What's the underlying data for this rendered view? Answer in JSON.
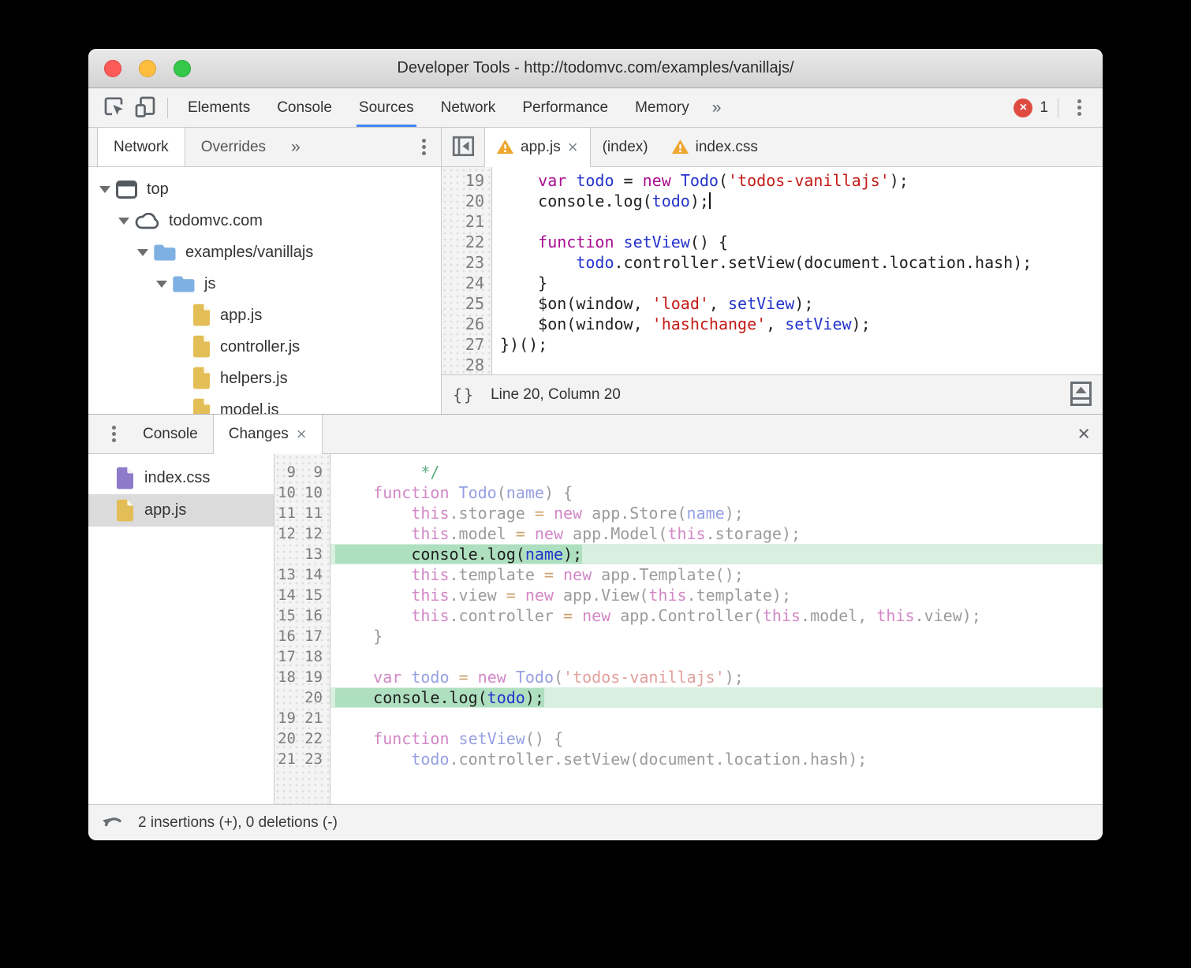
{
  "window": {
    "title": "Developer Tools - http://todomvc.com/examples/vanillajs/",
    "controls": [
      "close",
      "minimize",
      "maximize"
    ]
  },
  "colors": {
    "accent_blue": "#4285f4",
    "error_red": "#df4b41",
    "warning_amber": "#efa62f",
    "folder_blue": "#7fb0e3",
    "js_file_yellow": "#e3bd56",
    "css_file_purple": "#8d7ac9",
    "added_line_bg": "#d9efe0",
    "added_text_bg": "#aedfbf"
  },
  "ui": {
    "close_glyph": "×"
  },
  "toolbar": {
    "tabs": [
      "Elements",
      "Console",
      "Sources",
      "Network",
      "Performance",
      "Memory"
    ],
    "selected_tab": "Sources",
    "more_tabs_glyph": "»",
    "error_glyph": "×",
    "error_count": "1"
  },
  "sources": {
    "sidebar": {
      "tabs": [
        "Network",
        "Overrides"
      ],
      "selected_tab": "Network",
      "more_tabs_glyph": "»",
      "tree": [
        {
          "label": "top",
          "depth": 0,
          "icon": "frame-icon",
          "expanded": true
        },
        {
          "label": "todomvc.com",
          "depth": 1,
          "icon": "cloud-icon",
          "expanded": true
        },
        {
          "label": "examples/vanillajs",
          "depth": 2,
          "icon": "folder-icon",
          "expanded": true
        },
        {
          "label": "js",
          "depth": 3,
          "icon": "folder-icon",
          "expanded": true
        },
        {
          "label": "app.js",
          "depth": 4,
          "icon": "file-js-icon"
        },
        {
          "label": "controller.js",
          "depth": 4,
          "icon": "file-js-icon"
        },
        {
          "label": "helpers.js",
          "depth": 4,
          "icon": "file-js-icon"
        },
        {
          "label": "model.js",
          "depth": 4,
          "icon": "file-js-icon"
        }
      ]
    },
    "editor": {
      "tabs": [
        {
          "label": "app.js",
          "warning": true,
          "closable": true,
          "active": true
        },
        {
          "label": "(index)",
          "warning": false,
          "closable": false,
          "active": false
        },
        {
          "label": "index.css",
          "warning": true,
          "closable": false,
          "active": false
        }
      ],
      "lines": [
        {
          "num": "19",
          "tokens": [
            [
              "p",
              "    "
            ],
            [
              "k",
              "var"
            ],
            [
              "p",
              " "
            ],
            [
              "v",
              "todo"
            ],
            [
              "p",
              " = "
            ],
            [
              "k",
              "new"
            ],
            [
              "p",
              " "
            ],
            [
              "v",
              "Todo"
            ],
            [
              "p",
              "("
            ],
            [
              "s",
              "'todos-vanillajs'"
            ],
            [
              "p",
              ");"
            ]
          ]
        },
        {
          "num": "20",
          "cursor": true,
          "tokens": [
            [
              "p",
              "    console.log("
            ],
            [
              "v",
              "todo"
            ],
            [
              "p",
              ");"
            ]
          ]
        },
        {
          "num": "21",
          "tokens": []
        },
        {
          "num": "22",
          "tokens": [
            [
              "p",
              "    "
            ],
            [
              "k",
              "function"
            ],
            [
              "p",
              " "
            ],
            [
              "v",
              "setView"
            ],
            [
              "p",
              "() {"
            ]
          ]
        },
        {
          "num": "23",
          "tokens": [
            [
              "p",
              "        "
            ],
            [
              "v",
              "todo"
            ],
            [
              "p",
              ".controller.setView(document.location.hash);"
            ]
          ]
        },
        {
          "num": "24",
          "tokens": [
            [
              "p",
              "    }"
            ]
          ]
        },
        {
          "num": "25",
          "tokens": [
            [
              "p",
              "    $on(window, "
            ],
            [
              "s",
              "'load'"
            ],
            [
              "p",
              ", "
            ],
            [
              "v",
              "setView"
            ],
            [
              "p",
              ");"
            ]
          ]
        },
        {
          "num": "26",
          "tokens": [
            [
              "p",
              "    $on(window, "
            ],
            [
              "s",
              "'hashchange'"
            ],
            [
              "p",
              ", "
            ],
            [
              "v",
              "setView"
            ],
            [
              "p",
              ");"
            ]
          ]
        },
        {
          "num": "27",
          "tokens": [
            [
              "p",
              "})();"
            ]
          ]
        },
        {
          "num": "28",
          "tokens": []
        }
      ],
      "pretty_print_label": "{}",
      "cursor_position": "Line 20, Column 20"
    }
  },
  "drawer": {
    "tabs": [
      {
        "label": "Console",
        "active": false,
        "closable": false
      },
      {
        "label": "Changes",
        "active": true,
        "closable": true
      }
    ],
    "changes": {
      "files": [
        {
          "label": "index.css",
          "icon": "file-css-icon",
          "selected": false
        },
        {
          "label": "app.js",
          "icon": "file-js-icon",
          "selected": true
        }
      ],
      "diff": [
        {
          "old": "9",
          "new": "9",
          "added": false,
          "tokens": [
            [
              "c",
              "         */"
            ]
          ]
        },
        {
          "old": "10",
          "new": "10",
          "added": false,
          "tokens": [
            [
              "p",
              "    "
            ],
            [
              "k",
              "function"
            ],
            [
              "p",
              " "
            ],
            [
              "v",
              "Todo"
            ],
            [
              "p",
              "("
            ],
            [
              "v",
              "name"
            ],
            [
              "p",
              ") {"
            ]
          ]
        },
        {
          "old": "11",
          "new": "11",
          "added": false,
          "tokens": [
            [
              "p",
              "        "
            ],
            [
              "k",
              "this"
            ],
            [
              "p",
              ".storage "
            ],
            [
              "o",
              "="
            ],
            [
              "p",
              " "
            ],
            [
              "k",
              "new"
            ],
            [
              "p",
              " app.Store("
            ],
            [
              "v",
              "name"
            ],
            [
              "p",
              ");"
            ]
          ]
        },
        {
          "old": "12",
          "new": "12",
          "added": false,
          "tokens": [
            [
              "p",
              "        "
            ],
            [
              "k",
              "this"
            ],
            [
              "p",
              ".model "
            ],
            [
              "o",
              "="
            ],
            [
              "p",
              " "
            ],
            [
              "k",
              "new"
            ],
            [
              "p",
              " app.Model("
            ],
            [
              "k",
              "this"
            ],
            [
              "p",
              ".storage);"
            ]
          ]
        },
        {
          "old": "",
          "new": "13",
          "added": true,
          "tokens": [
            [
              "p",
              "        console.log("
            ],
            [
              "v",
              "name"
            ],
            [
              "p",
              ");"
            ]
          ]
        },
        {
          "old": "13",
          "new": "14",
          "added": false,
          "tokens": [
            [
              "p",
              "        "
            ],
            [
              "k",
              "this"
            ],
            [
              "p",
              ".template "
            ],
            [
              "o",
              "="
            ],
            [
              "p",
              " "
            ],
            [
              "k",
              "new"
            ],
            [
              "p",
              " app.Template();"
            ]
          ]
        },
        {
          "old": "14",
          "new": "15",
          "added": false,
          "tokens": [
            [
              "p",
              "        "
            ],
            [
              "k",
              "this"
            ],
            [
              "p",
              ".view "
            ],
            [
              "o",
              "="
            ],
            [
              "p",
              " "
            ],
            [
              "k",
              "new"
            ],
            [
              "p",
              " app.View("
            ],
            [
              "k",
              "this"
            ],
            [
              "p",
              ".template);"
            ]
          ]
        },
        {
          "old": "15",
          "new": "16",
          "added": false,
          "tokens": [
            [
              "p",
              "        "
            ],
            [
              "k",
              "this"
            ],
            [
              "p",
              ".controller "
            ],
            [
              "o",
              "="
            ],
            [
              "p",
              " "
            ],
            [
              "k",
              "new"
            ],
            [
              "p",
              " app.Controller("
            ],
            [
              "k",
              "this"
            ],
            [
              "p",
              ".model, "
            ],
            [
              "k",
              "this"
            ],
            [
              "p",
              ".view);"
            ]
          ]
        },
        {
          "old": "16",
          "new": "17",
          "added": false,
          "tokens": [
            [
              "p",
              "    }"
            ]
          ]
        },
        {
          "old": "17",
          "new": "18",
          "added": false,
          "tokens": []
        },
        {
          "old": "18",
          "new": "19",
          "added": false,
          "tokens": [
            [
              "p",
              "    "
            ],
            [
              "k",
              "var"
            ],
            [
              "p",
              " "
            ],
            [
              "v",
              "todo"
            ],
            [
              "p",
              " "
            ],
            [
              "o",
              "="
            ],
            [
              "p",
              " "
            ],
            [
              "k",
              "new"
            ],
            [
              "p",
              " "
            ],
            [
              "v",
              "Todo"
            ],
            [
              "p",
              "("
            ],
            [
              "s",
              "'todos-vanillajs'"
            ],
            [
              "p",
              ");"
            ]
          ]
        },
        {
          "old": "",
          "new": "20",
          "added": true,
          "tokens": [
            [
              "p",
              "    console.log("
            ],
            [
              "v",
              "todo"
            ],
            [
              "p",
              ");"
            ]
          ]
        },
        {
          "old": "19",
          "new": "21",
          "added": false,
          "tokens": []
        },
        {
          "old": "20",
          "new": "22",
          "added": false,
          "tokens": [
            [
              "p",
              "    "
            ],
            [
              "k",
              "function"
            ],
            [
              "p",
              " "
            ],
            [
              "v",
              "setView"
            ],
            [
              "p",
              "() {"
            ]
          ]
        },
        {
          "old": "21",
          "new": "23",
          "added": false,
          "tokens": [
            [
              "p",
              "        "
            ],
            [
              "v",
              "todo"
            ],
            [
              "p",
              ".controller.setView(document.location.hash);"
            ]
          ]
        }
      ],
      "status": "2 insertions (+), 0 deletions (-)"
    }
  }
}
